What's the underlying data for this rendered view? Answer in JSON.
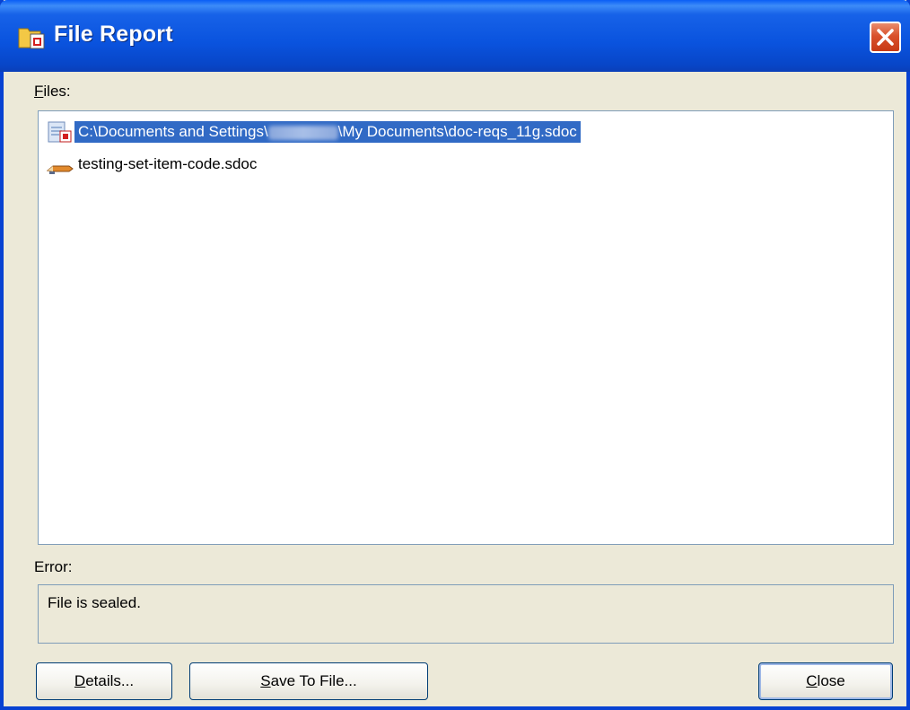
{
  "window": {
    "title": "File Report",
    "title_icon": "folder-document-icon",
    "close_icon": "close-icon"
  },
  "files": {
    "label": "Files:",
    "label_accel": "F",
    "label_rest": "iles:",
    "items": [
      {
        "path_prefix": "C:\\Documents and Settings\\",
        "path_suffix": "\\My Documents\\doc-reqs_11g.sdoc",
        "icon": "sealed-document-icon",
        "selected": true
      },
      {
        "text": "testing-set-item-code.sdoc",
        "icon": "pencil-document-icon",
        "selected": false
      }
    ]
  },
  "error": {
    "label": "Error:",
    "message": "File is sealed."
  },
  "buttons": {
    "details": {
      "label": "Details...",
      "accel": "D",
      "rest": "etails..."
    },
    "save": {
      "label": "Save To File...",
      "accel": "S",
      "rest": "ave To File..."
    },
    "close": {
      "label": "Close",
      "accel": "C",
      "rest": "lose"
    }
  },
  "colors": {
    "titlebar": "#0a53de",
    "selection": "#316ac5",
    "face": "#ece9d8",
    "border": "#7f9db9"
  }
}
